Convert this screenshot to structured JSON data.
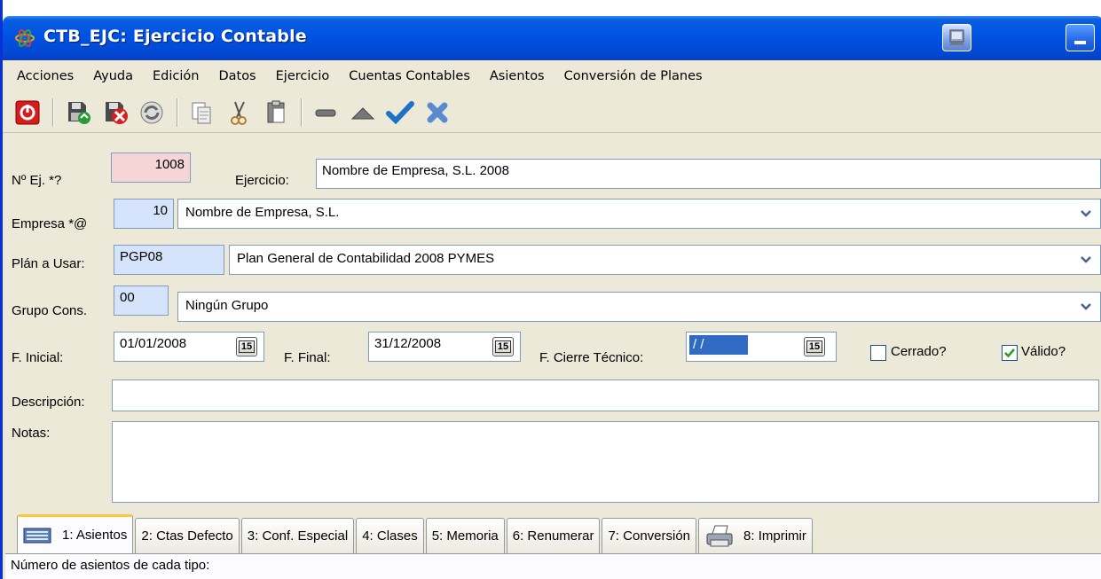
{
  "window": {
    "title": "CTB_EJC: Ejercicio Contable",
    "icons": {
      "app": "atom-icon",
      "special": "screen-icon",
      "minimize": "minimize-icon"
    }
  },
  "menu": [
    "Acciones",
    "Ayuda",
    "Edición",
    "Datos",
    "Ejercicio",
    "Cuentas Contables",
    "Asientos",
    "Conversión de Planes"
  ],
  "toolbar": {
    "icons": [
      "power-icon",
      "save-icon",
      "delete-icon",
      "refresh-icon",
      "copy-icon",
      "cut-icon",
      "paste-icon",
      "minus-icon",
      "up-triangle-icon",
      "check-icon",
      "cancel-x-icon"
    ]
  },
  "form": {
    "num_ej_label": "Nº Ej. *?",
    "num_ej_value": "1008",
    "ejercicio_label": "Ejercicio:",
    "ejercicio_value": "Nombre de Empresa, S.L. 2008",
    "empresa_label": "Empresa *@",
    "empresa_code": "10",
    "empresa_name": "Nombre de Empresa, S.L.",
    "plan_label": "Plán a Usar:",
    "plan_code": "PGP08",
    "plan_name": "Plan General de Contabilidad 2008 PYMES",
    "grupo_label": "Grupo Cons.",
    "grupo_code": "00",
    "grupo_name": "Ningún Grupo",
    "f_inicial_label": "F. Inicial:",
    "f_inicial_value": "01/01/2008",
    "f_final_label": "F. Final:",
    "f_final_value": "31/12/2008",
    "f_cierre_label": "F. Cierre Técnico:",
    "f_cierre_value": " / /",
    "calendar_label": "15",
    "cerrado_label": "Cerrado?",
    "cerrado_checked": false,
    "valido_label": "Válido?",
    "valido_checked": true,
    "descripcion_label": "Descripción:",
    "descripcion_value": "",
    "notas_label": "Notas:",
    "notas_value": ""
  },
  "tabs": [
    {
      "label": "1: Asientos",
      "active": true
    },
    {
      "label": "2: Ctas Defecto"
    },
    {
      "label": "3: Conf. Especial"
    },
    {
      "label": "4: Clases"
    },
    {
      "label": "5: Memoria"
    },
    {
      "label": "6: Renumerar"
    },
    {
      "label": "7: Conversión"
    },
    {
      "label": "8: Imprimir"
    }
  ],
  "tab_panel_text": "Número de asientos de cada tipo:"
}
